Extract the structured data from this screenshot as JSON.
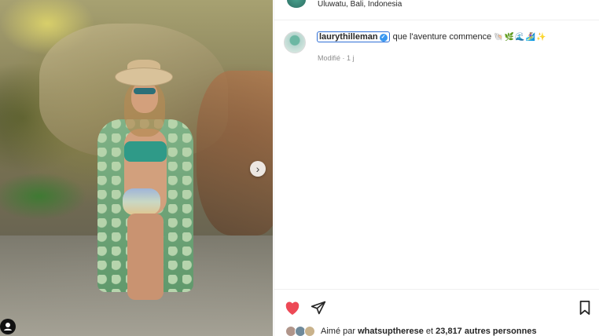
{
  "post": {
    "location": "Uluwatu, Bali, Indonesia",
    "caption": {
      "username": "laurythilleman",
      "text": "que l'aventure commence",
      "emojis": "🐚🌿🌊🏄‍♀️✨"
    },
    "meta": "Modifié · 1 j",
    "likes": {
      "prefix": "Aimé par",
      "user": "whatsuptherese",
      "middle": "et",
      "count": "23,817 autres personnes"
    }
  },
  "icons": {
    "like": "heart-icon",
    "share": "send-icon",
    "save": "bookmark-icon",
    "next": "chevron-right-icon",
    "tag": "user-tag-icon",
    "verified": "verified-badge-icon"
  },
  "colors": {
    "like": "#ed4956",
    "verified": "#3897f0",
    "selection_outline": "#2f6fd6"
  }
}
